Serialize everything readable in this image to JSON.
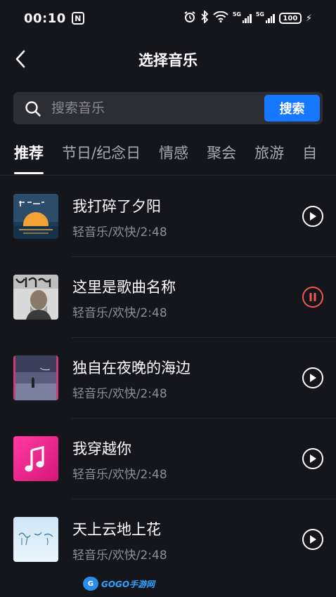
{
  "status_bar": {
    "time": "00:10",
    "nfc": "N",
    "signal_1": "5G",
    "signal_2": "5G",
    "battery": "100"
  },
  "header": {
    "title": "选择音乐",
    "back_icon": "chevron-left-icon"
  },
  "search": {
    "placeholder": "搜索音乐",
    "button_label": "搜索",
    "icon": "search-icon",
    "accent": "#1677ff"
  },
  "tabs": [
    {
      "label": "推荐",
      "active": true
    },
    {
      "label": "节日/纪念日",
      "active": false
    },
    {
      "label": "情感",
      "active": false
    },
    {
      "label": "聚会",
      "active": false
    },
    {
      "label": "旅游",
      "active": false
    },
    {
      "label": "自",
      "active": false
    }
  ],
  "songs": [
    {
      "title": "我打碎了夕阳",
      "meta": "轻音乐/欢快/2:48",
      "state": "play",
      "cover": "sunset-cover"
    },
    {
      "title": "这里是歌曲名称",
      "meta": "轻音乐/欢快/2:48",
      "state": "pause",
      "cover": "portrait-cover"
    },
    {
      "title": "独自在夜晚的海边",
      "meta": "轻音乐/欢快/2:48",
      "state": "play",
      "cover": "night-sea-cover"
    },
    {
      "title": "我穿越你",
      "meta": "轻音乐/欢快/2:48",
      "state": "play",
      "cover": "music-note-cover"
    },
    {
      "title": "天上云地上花",
      "meta": "轻音乐/欢快/2:48",
      "state": "play",
      "cover": "sky-cover"
    }
  ],
  "colors": {
    "background": "#15151c",
    "playing_accent": "#ee5a4f"
  },
  "watermark": {
    "logo_text": "G",
    "text": "GOGO手游网"
  }
}
